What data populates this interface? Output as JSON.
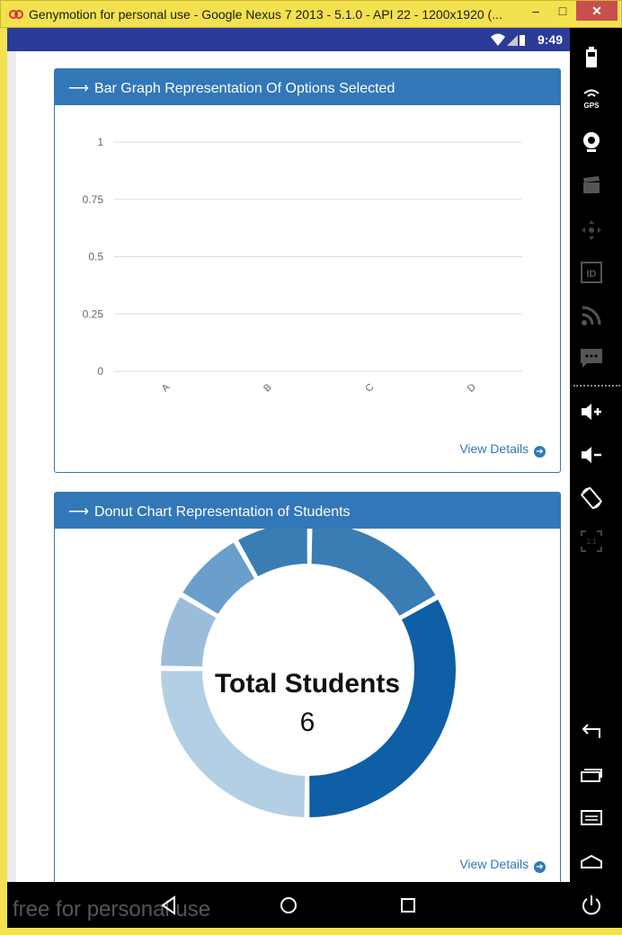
{
  "window": {
    "title": "Genymotion for personal use - Google Nexus 7 2013 - 5.1.0 - API 22 - 1200x1920 (...",
    "minimize_glyph": "–",
    "maximize_glyph": "□",
    "close_glyph": "✕"
  },
  "status_bar": {
    "time": "9:49",
    "icons": [
      "wifi-icon",
      "signal-icon",
      "battery-icon"
    ]
  },
  "bar_panel": {
    "title": "Bar Graph Representation Of Options Selected",
    "view_details": "View Details"
  },
  "donut_panel": {
    "title": "Donut Chart Representation of Students",
    "view_details": "View Details",
    "center_title": "Total Students",
    "center_value": "6"
  },
  "chart_data": [
    {
      "type": "bar",
      "categories": [
        "A",
        "B",
        "C",
        "D"
      ],
      "values": [
        0,
        0,
        0,
        0
      ],
      "y_ticks": [
        "1",
        "0.75",
        "0.5",
        "0.25",
        "0"
      ],
      "ylim": [
        0,
        1
      ],
      "grid": true
    },
    {
      "type": "pie",
      "style": "donut",
      "values": [
        1,
        2,
        1.5,
        0.5,
        0.5,
        0.5
      ],
      "colors": [
        "#3a7db5",
        "#0e5fa6",
        "#b3cfe3",
        "#9bbddb",
        "#6a9fcb",
        "#3a7db5"
      ]
    }
  ],
  "navbar": {
    "watermark": "free for personal use",
    "buttons": [
      "back-icon",
      "home-icon",
      "recents-icon"
    ]
  },
  "sidebar": {
    "tools": [
      "battery-icon",
      "gps-icon",
      "camera-icon",
      "clapper-icon",
      "dpad-icon",
      "id-icon",
      "rss-icon",
      "sms-icon",
      "volume-up-icon",
      "volume-down-icon",
      "rotate-icon",
      "pixel-perfect-icon",
      "back-icon",
      "recents-icon",
      "menu-icon",
      "home-icon",
      "power-icon"
    ],
    "gps_label": "GPS",
    "id_label": "ID",
    "pixel_label": "1:1"
  },
  "colors": {
    "accent": "#3277b8",
    "status_bar": "#2b3b98",
    "title_bar": "#f4e14f"
  }
}
